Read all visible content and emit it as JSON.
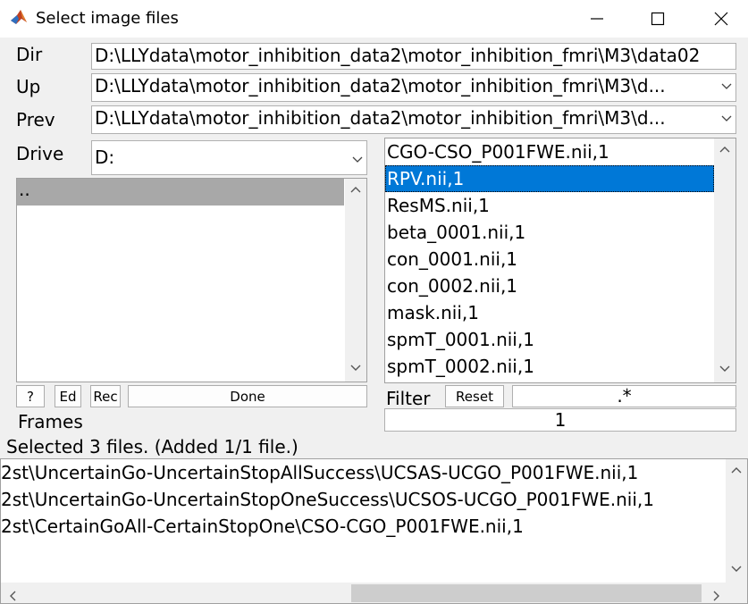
{
  "window": {
    "title": "Select image files",
    "minimize": "—",
    "maximize": "☐",
    "close": "✕"
  },
  "dir": {
    "label": "Dir",
    "value": "D:\\LLYdata\\motor_inhibition_data2\\motor_inhibition_fmri\\M3\\data02"
  },
  "up": {
    "label": "Up",
    "value": "D:\\LLYdata\\motor_inhibition_data2\\motor_inhibition_fmri\\M3\\d..."
  },
  "prev": {
    "label": "Prev",
    "value": "D:\\LLYdata\\motor_inhibition_data2\\motor_inhibition_fmri\\M3\\d..."
  },
  "drive": {
    "label": "Drive",
    "value": "D:"
  },
  "dir_list": {
    "items": [
      ".."
    ]
  },
  "file_list": {
    "items": [
      "CGO-CSO_P001FWE.nii,1",
      "RPV.nii,1",
      "ResMS.nii,1",
      "beta_0001.nii,1",
      "con_0001.nii,1",
      "con_0002.nii,1",
      "mask.nii,1",
      "spmT_0001.nii,1",
      "spmT_0002.nii,1"
    ],
    "selected": "RPV.nii,1"
  },
  "buttons": {
    "help": "?",
    "ed": "Ed",
    "rec": "Rec",
    "done": "Done",
    "reset": "Reset"
  },
  "filter": {
    "label": "Filter",
    "value": ".*"
  },
  "frames": {
    "label": "Frames",
    "value": "1"
  },
  "status": "Selected 3 files. (Added 1/1 file.)",
  "selected_files": [
    "2st\\UncertainGo-UncertainStopAllSuccess\\UCSAS-UCGO_P001FWE.nii,1",
    "2st\\UncertainGo-UncertainStopOneSuccess\\UCSOS-UCGO_P001FWE.nii,1",
    "2st\\CertainGoAll-CertainStopOne\\CSO-CGO_P001FWE.nii,1"
  ],
  "icons": {
    "app": "matlab-icon",
    "dropdown": "chevron-down-icon"
  }
}
